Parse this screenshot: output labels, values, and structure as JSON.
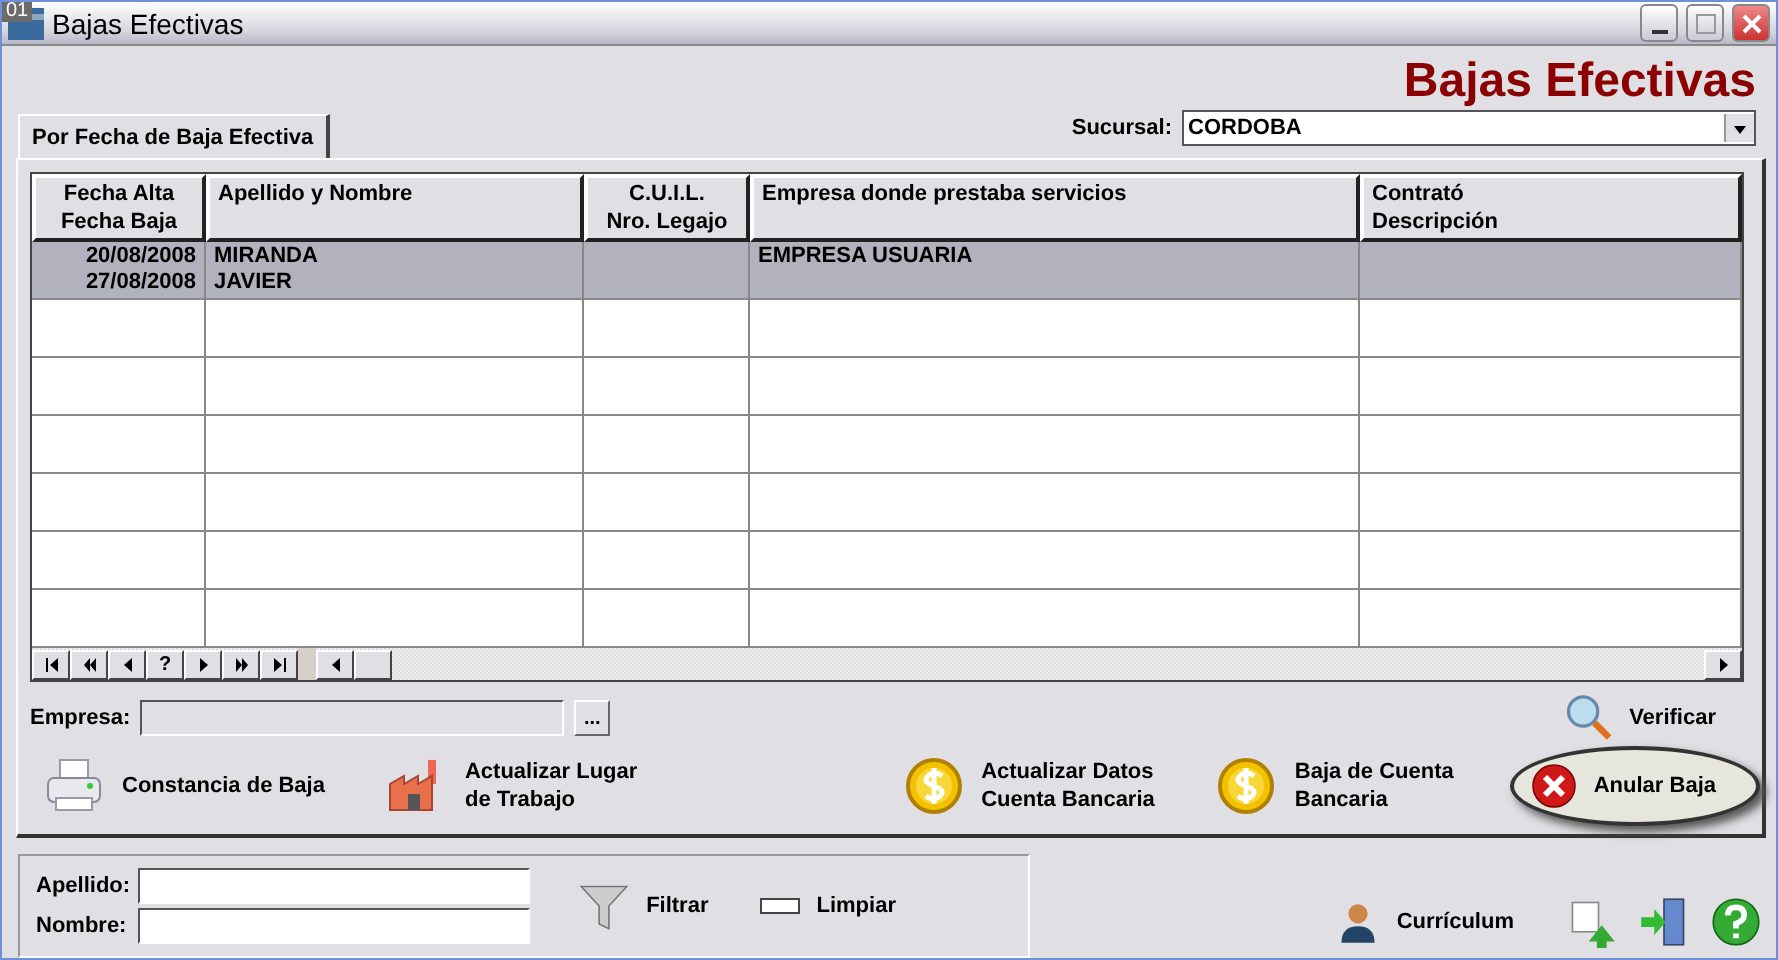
{
  "window": {
    "title": "Bajas Efectivas",
    "badge": "01"
  },
  "heading": "Bajas Efectivas",
  "tabs": [
    {
      "label": "Por Fecha de Baja Efectiva",
      "selected": true
    }
  ],
  "sucursal": {
    "label": "Sucursal:",
    "value": "CORDOBA"
  },
  "table": {
    "columns": [
      {
        "line1": "Fecha Alta",
        "line2": "Fecha Baja"
      },
      {
        "line1": "Apellido y Nombre"
      },
      {
        "line1": "C.U.I.L.",
        "line2": "Nro. Legajo"
      },
      {
        "line1": "Empresa donde prestaba servicios"
      },
      {
        "line1": "Contrató",
        "line2": "Descripción"
      }
    ],
    "rows": [
      {
        "selected": true,
        "fecha_alta": "20/08/2008",
        "fecha_baja": "27/08/2008",
        "apellido": "MIRANDA",
        "nombre": "JAVIER",
        "empresa": "EMPRESA USUARIA"
      }
    ]
  },
  "navigator": {
    "help": "?"
  },
  "empresa": {
    "label": "Empresa:",
    "button": "..."
  },
  "verify": {
    "label": "Verificar"
  },
  "actions": [
    {
      "kind": "printer",
      "lines": [
        "Constancia de Baja"
      ],
      "highlighted": false
    },
    {
      "kind": "factory",
      "lines": [
        "Actualizar Lugar",
        "de Trabajo"
      ],
      "highlighted": false
    },
    {
      "kind": "coin",
      "lines": [
        "Actualizar Datos",
        "Cuenta Bancaria"
      ],
      "highlighted": false
    },
    {
      "kind": "coin",
      "lines": [
        "Baja de Cuenta",
        "Bancaria"
      ],
      "highlighted": false
    },
    {
      "kind": "cancel",
      "lines": [
        "Anular Baja"
      ],
      "highlighted": true
    }
  ],
  "filter": {
    "fields": [
      {
        "label": "Apellido:"
      },
      {
        "label": "Nombre:"
      }
    ],
    "filter_button": "Filtrar",
    "clear_button": "Limpiar"
  },
  "footer": {
    "curriculum": "Currículum"
  }
}
